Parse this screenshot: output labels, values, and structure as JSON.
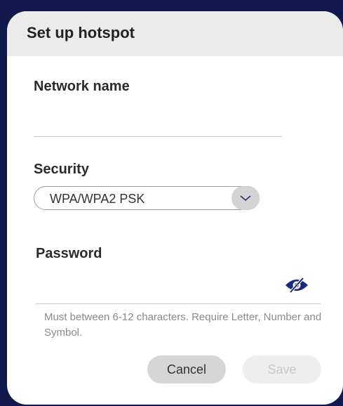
{
  "dialog": {
    "title": "Set up hotspot",
    "network": {
      "label": "Network name",
      "value": ""
    },
    "security": {
      "label": "Security",
      "selected": "WPA/WPA2 PSK"
    },
    "password": {
      "label": "Password",
      "value": "",
      "hint": "Must between 6-12 characters. Require Letter, Number and Symbol."
    },
    "buttons": {
      "cancel": "Cancel",
      "save": "Save"
    }
  },
  "colors": {
    "backdrop": "#11184d",
    "header_bg": "#ebebeb",
    "eye_icon": "#1a2a7a",
    "save_disabled_text": "#c9c9c9"
  },
  "icons": {
    "dropdown": "chevron-down-icon",
    "visibility": "eye-slash-icon"
  }
}
